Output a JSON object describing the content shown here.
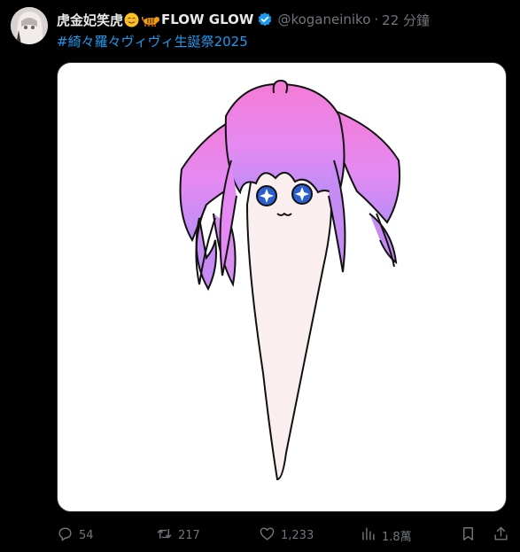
{
  "tweet": {
    "author_name": "虎金妃笑虎",
    "author_name_2": "FLOW GLOW",
    "handle": "@koganeiniko",
    "separator": "·",
    "time": "22 分鐘",
    "hashtag": "#綺々羅々ヴィヴィ生誕祭2025"
  },
  "actions": {
    "replies": "54",
    "reposts": "217",
    "likes": "1,233",
    "views": "1.8萬"
  },
  "icons": {
    "emoji_1": "smiling-face-icon",
    "emoji_2": "tiger-icon",
    "verified": "verified-badge-icon",
    "reply": "reply-icon",
    "repost": "repost-icon",
    "like": "heart-icon",
    "views": "bar-chart-icon",
    "bookmark": "bookmark-icon",
    "share": "share-icon"
  },
  "colors": {
    "background": "#000000",
    "link": "#1d9bf0",
    "muted": "#71767b",
    "verified": "#1d9bf0"
  }
}
